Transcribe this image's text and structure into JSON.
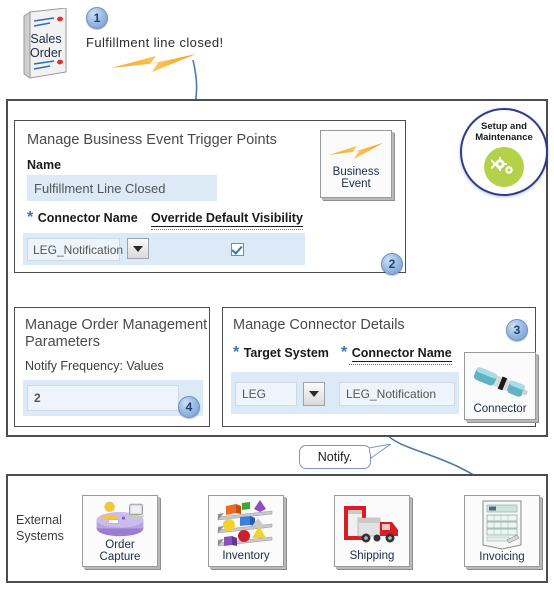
{
  "top": {
    "sales_order_label_line1": "Sales",
    "sales_order_label_line2": "Order",
    "badge_1": "1",
    "event_caption": "Fulfillment line closed!"
  },
  "setup_badge": {
    "line1": "Setup and",
    "line2": "Maintenance",
    "icon": "gears-icon"
  },
  "panel2": {
    "title": "Manage Business Event Trigger Points",
    "name_label": "Name",
    "name_value": "Fulfillment Line Closed",
    "connector_name_label": "Connector Name",
    "connector_required": "*",
    "override_label": "Override Default Visibility",
    "connector_value": "LEG_Notification",
    "override_checked": true,
    "badge": "2",
    "icon_label_line1": "Business",
    "icon_label_line2": "Event",
    "icon": "lightning-bolt-icon"
  },
  "panel4": {
    "title_line1": "Manage Order Management",
    "title_line2": "Parameters",
    "field_label": "Notify Frequency: Values",
    "field_value": "2",
    "badge": "4"
  },
  "panel3": {
    "title": "Manage Connector Details",
    "target_system_label": "Target System",
    "target_system_required": "*",
    "connector_name_label": "Connector Name",
    "connector_name_required": "*",
    "target_system_value": "LEG",
    "connector_name_value": "LEG_Notification",
    "badge": "3",
    "icon_label": "Connector",
    "icon": "connector-plug-icon"
  },
  "notify_callout": "Notify.",
  "external": {
    "label_line1": "External",
    "label_line2": "Systems",
    "systems": [
      {
        "label_line1": "Order",
        "label_line2": "Capture",
        "icon": "order-capture-icon"
      },
      {
        "label_line1": "Inventory",
        "label_line2": "",
        "icon": "inventory-icon"
      },
      {
        "label_line1": "Shipping",
        "label_line2": "",
        "icon": "shipping-truck-icon"
      },
      {
        "label_line1": "Invoicing",
        "label_line2": "",
        "icon": "invoice-document-icon"
      }
    ]
  },
  "colors": {
    "field_blue": "#dce9f7",
    "accent_orange": "#f5a623",
    "arrow_blue": "#4a79ab",
    "badge_blue": "#6f9ad3",
    "setup_green": "#b5d14a"
  }
}
